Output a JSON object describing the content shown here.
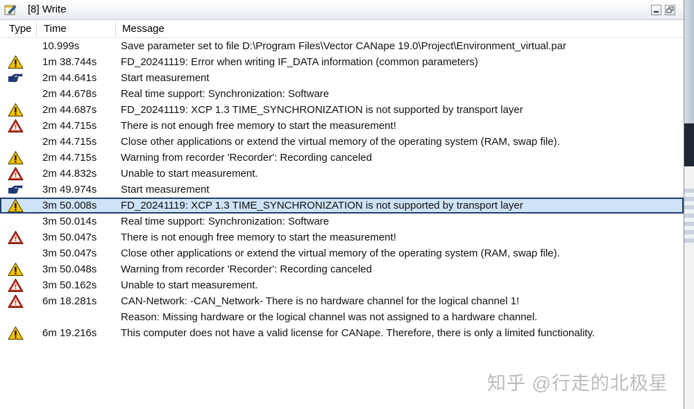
{
  "window": {
    "title": "[8] Write"
  },
  "columns": {
    "type": "Type",
    "time": "Time",
    "message": "Message"
  },
  "rows": [
    {
      "icon": "none",
      "time": "10.999s",
      "message": "Save parameter set to file D:\\Program Files\\Vector CANape 19.0\\Project\\Environment_virtual.par"
    },
    {
      "icon": "warning",
      "time": "1m 38.744s",
      "message": "FD_20241119: Error when writing IF_DATA information (common parameters)"
    },
    {
      "icon": "hand",
      "time": "2m 44.641s",
      "message": "Start measurement"
    },
    {
      "icon": "none",
      "time": "2m 44.678s",
      "message": "Real time support: Synchronization: Software"
    },
    {
      "icon": "warning",
      "time": "2m 44.687s",
      "message": "FD_20241119: XCP 1.3 TIME_SYNCHRONIZATION is not supported by transport layer"
    },
    {
      "icon": "error",
      "time": "2m 44.715s",
      "message": "There is not enough free memory to start the measurement!"
    },
    {
      "icon": "none",
      "time": "2m 44.715s",
      "message": "Close other applications or extend the virtual memory of the operating system (RAM, swap file)."
    },
    {
      "icon": "warning",
      "time": "2m 44.715s",
      "message": "Warning from recorder 'Recorder': Recording canceled"
    },
    {
      "icon": "error",
      "time": "2m 44.832s",
      "message": "Unable to start measurement."
    },
    {
      "icon": "hand",
      "time": "3m 49.974s",
      "message": "Start measurement"
    },
    {
      "icon": "warning",
      "time": "3m 50.008s",
      "message": "FD_20241119: XCP 1.3 TIME_SYNCHRONIZATION is not supported by transport layer",
      "selected": true
    },
    {
      "icon": "none",
      "time": "3m 50.014s",
      "message": "Real time support: Synchronization: Software"
    },
    {
      "icon": "error",
      "time": "3m 50.047s",
      "message": "There is not enough free memory to start the measurement!"
    },
    {
      "icon": "none",
      "time": "3m 50.047s",
      "message": "Close other applications or extend the virtual memory of the operating system (RAM, swap file)."
    },
    {
      "icon": "warning",
      "time": "3m 50.048s",
      "message": "Warning from recorder 'Recorder': Recording canceled"
    },
    {
      "icon": "error",
      "time": "3m 50.162s",
      "message": "Unable to start measurement."
    },
    {
      "icon": "error",
      "time": "6m 18.281s",
      "message": "CAN-Network: -CAN_Network- There is no hardware channel for the logical channel 1!"
    },
    {
      "icon": "none",
      "time": "",
      "message": "Reason: Missing hardware or the logical channel was not assigned to a hardware channel."
    },
    {
      "icon": "warning",
      "time": "6m 19.216s",
      "message": "This computer does not have a valid license for CANape. Therefore, there is only a limited functionality."
    }
  ],
  "watermark": "知乎 @行走的北极星",
  "colors": {
    "selection": "#cfe3f7",
    "warning": "#f3c400",
    "error": "#c8341e",
    "hand": "#203c78"
  }
}
